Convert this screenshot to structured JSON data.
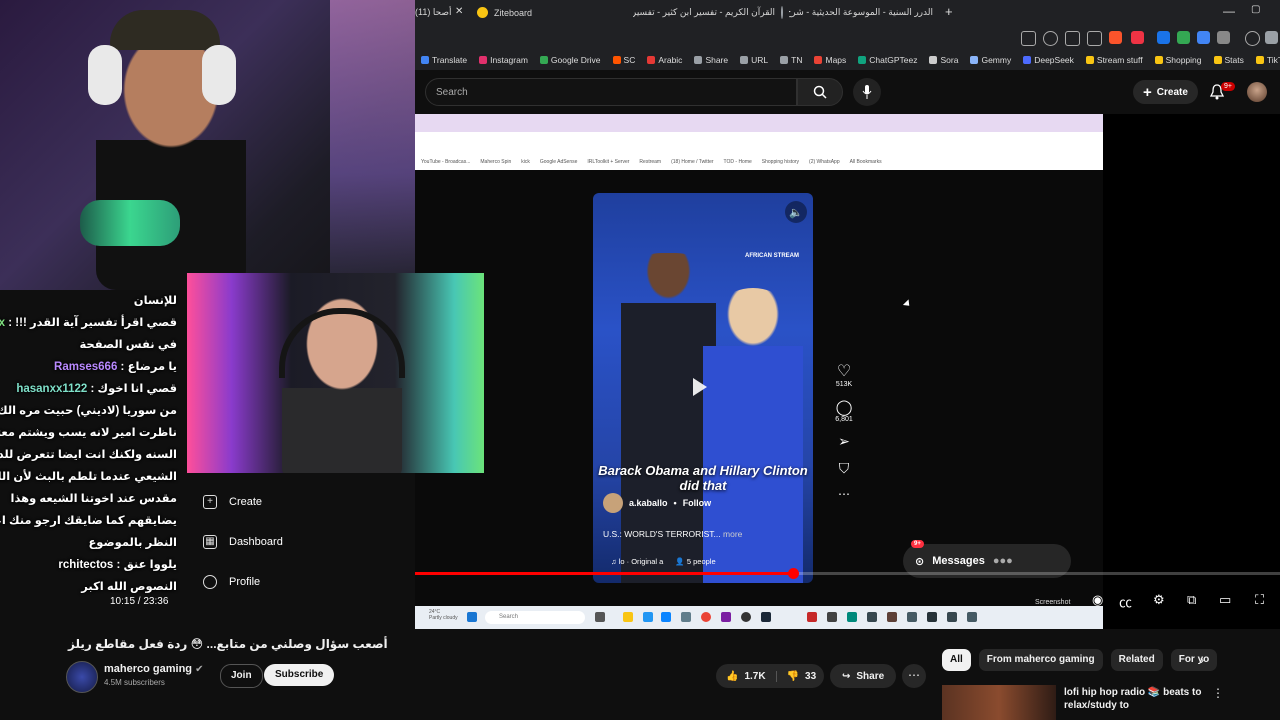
{
  "browser": {
    "tabs": [
      {
        "label": "(11) أصحا",
        "color": "#ff0000"
      },
      {
        "label": "Ziteboard",
        "color": "#f9c513"
      },
      {
        "label": "القرآن الكريم - تفسير ابن كثير - تفسير",
        "color": "#9aa0a6"
      },
      {
        "label": "الدرر السنية - الموسوعة الحديثية - شرح",
        "color": "#ffffff"
      }
    ],
    "new_tab": "+",
    "bookmarks": [
      {
        "label": "Translate",
        "color": "#4285f4"
      },
      {
        "label": "Instagram",
        "color": "#e1306c"
      },
      {
        "label": "Google Drive",
        "color": "#34a853"
      },
      {
        "label": "SC",
        "color": "#ff5500"
      },
      {
        "label": "Arabic",
        "color": "#e53935"
      },
      {
        "label": "Share",
        "color": "#9aa0a6"
      },
      {
        "label": "URL",
        "color": "#9aa0a6"
      },
      {
        "label": "TN",
        "color": "#9aa0a6"
      },
      {
        "label": "Maps",
        "color": "#ea4335"
      },
      {
        "label": "ChatGPTeez",
        "color": "#10a37f"
      },
      {
        "label": "Sora",
        "color": "#cccccc"
      },
      {
        "label": "Gemmy",
        "color": "#8ab4f8"
      },
      {
        "label": "DeepSeek",
        "color": "#4d6bfe"
      },
      {
        "label": "Stream stuff",
        "color": "#f9c513"
      },
      {
        "label": "Shopping",
        "color": "#f9c513"
      },
      {
        "label": "Stats",
        "color": "#f9c513"
      },
      {
        "label": "TikTok",
        "color": "#f9c513"
      }
    ]
  },
  "masthead": {
    "search_placeholder": "Search",
    "create_label": "Create",
    "notif_badge": "9+"
  },
  "inner_browser": {
    "bookmarks": [
      "YouTube - Broadcas...",
      "Maherco Spin",
      "kick",
      "Google AdSense",
      "IRLToolkit + Server",
      "Restream",
      "(18) Home / Twitter",
      "TOD - Home",
      "Shopping history",
      "(2) WhatsApp",
      "All Bookmarks"
    ]
  },
  "reel": {
    "logo": "AFRICAN STREAM",
    "caption": "Barack Obama and Hillary Clinton did that",
    "username": "a.kaballo",
    "follow": "Follow",
    "description": "U.S.: WORLD'S TERRORIST...",
    "more": "more",
    "audio": "lo · Original a",
    "people": "5 people",
    "likes": "513K",
    "comments": "6,801",
    "messages_label": "Messages",
    "messages_badge": "9+"
  },
  "taskbar": {
    "search": "Search",
    "weather_temp": "24°C",
    "weather_desc": "Partly cloudy",
    "screenshot_label": "Screenshot"
  },
  "chat": {
    "lines": [
      {
        "user": "",
        "text": "للإنسان"
      },
      {
        "user": "oujx",
        "text": "قصي اقرأ تفسير آية القدر !!!",
        "cls": "uname-green"
      },
      {
        "user": "",
        "text": "في نفس الصفحة"
      },
      {
        "user": "Ramses666",
        "text": "يا مرضاع",
        "cls": "uname-purple"
      },
      {
        "user": "hasanxx1122",
        "text": "قصي انا اخوك",
        "cls": "uname-teal"
      },
      {
        "user": "",
        "text": "من سوريا (لاديني) حبيت مره الك ما"
      },
      {
        "user": "",
        "text": "ناظرت امير لانه يسب ويشتم معتقدات"
      },
      {
        "user": "",
        "text": "السنه ولكنك انت ايضا تتعرض للدين"
      },
      {
        "user": "",
        "text": "الشيعي عندما تلطم بالبث لأن اللطم"
      },
      {
        "user": "",
        "text": "مقدس عند اخوتنا الشيعه وهذا"
      },
      {
        "user": "",
        "text": "يضايقهم كما ضايقك ارجو منك اعاده"
      },
      {
        "user": "",
        "text": "النظر بالموضوع"
      },
      {
        "user": "rchitectos",
        "text": "يلووا عنق",
        "cls": ""
      },
      {
        "user": "",
        "text": "النصوص الله اكبر"
      }
    ]
  },
  "menu": {
    "create": "Create",
    "dashboard": "Dashboard",
    "profile": "Profile"
  },
  "player": {
    "time": "10:15 / 23:36",
    "progress_fraction": 0.4373
  },
  "video": {
    "title": "أصعب سؤال وصلني من متابع... 😳 ردة فعل مقاطع ريلز",
    "channel": "maherco gaming",
    "subscribers": "4.5M subscribers",
    "join": "Join",
    "subscribe": "Subscribe",
    "likes": "1.7K",
    "dislikes": "33",
    "share": "Share",
    "more": "⋯"
  },
  "sidebar": {
    "chips": [
      {
        "label": "All",
        "active": true
      },
      {
        "label": "From maherco gaming",
        "active": false
      },
      {
        "label": "Related",
        "active": false
      },
      {
        "label": "For yo",
        "active": false
      }
    ],
    "rec_title": "lofi hip hop radio 📚 beats to relax/study to"
  },
  "colors": {
    "accent_red": "#ff0000",
    "bg": "#0f0f0f",
    "chip_bg": "#272727"
  }
}
